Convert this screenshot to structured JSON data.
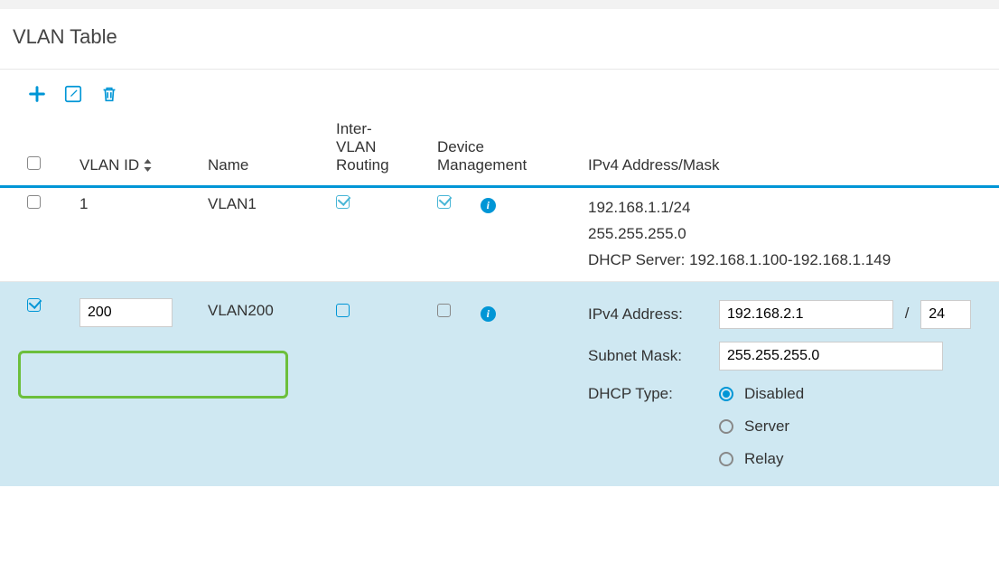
{
  "title": "VLAN Table",
  "columns": {
    "select": "",
    "vlan_id": "VLAN ID",
    "name": "Name",
    "inter_vlan": "Inter-\nVLAN\nRouting",
    "device_mgmt": "Device\nManagement",
    "ipv4": "IPv4 Address/Mask"
  },
  "rows": [
    {
      "selected": false,
      "vlan_id": "1",
      "name": "VLAN1",
      "inter_vlan_checked": true,
      "device_mgmt_checked": true,
      "ip_lines": {
        "addr": "192.168.1.1/24",
        "mask": "255.255.255.0",
        "dhcp": "DHCP Server: 192.168.1.100-192.168.1.149"
      }
    },
    {
      "selected": true,
      "vlan_id": "200",
      "name": "VLAN200",
      "inter_vlan_checked": false,
      "device_mgmt_checked": false,
      "form": {
        "ipv4_label": "IPv4 Address:",
        "ipv4_value": "192.168.2.1",
        "prefix": "24",
        "slash": "/",
        "subnet_label": "Subnet Mask:",
        "subnet_value": "255.255.255.0",
        "dhcp_label": "DHCP Type:",
        "dhcp_options": {
          "disabled": "Disabled",
          "server": "Server",
          "relay": "Relay"
        },
        "dhcp_selected": "disabled"
      }
    }
  ],
  "icons": {
    "info": "i"
  }
}
